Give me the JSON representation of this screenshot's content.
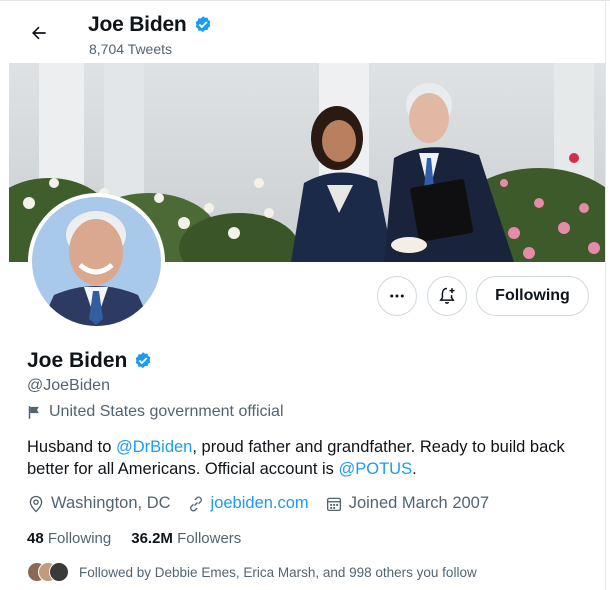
{
  "header": {
    "name": "Joe Biden",
    "tweet_count": "8,704 Tweets"
  },
  "icons": {
    "back": "arrow-left-icon",
    "verified": "verified-badge-icon",
    "more": "more-horizontal-icon",
    "notify": "bell-plus-icon",
    "affiliation": "flag-icon",
    "location": "location-pin-icon",
    "link": "link-icon",
    "joined": "calendar-icon"
  },
  "actions": {
    "following_label": "Following"
  },
  "profile": {
    "name": "Joe Biden",
    "handle": "@JoeBiden",
    "affiliation": "United States government official",
    "bio_part1": "Husband to ",
    "bio_mention1": "@DrBiden",
    "bio_part2": ", proud father and grandfather. Ready to build back better for all Americans. Official account is ",
    "bio_mention2": "@POTUS",
    "bio_part3": ".",
    "location": "Washington, DC",
    "website": "joebiden.com",
    "joined": "Joined March 2007"
  },
  "stats": {
    "following_count": "48",
    "following_label": "Following",
    "followers_count": "36.2M",
    "followers_label": "Followers"
  },
  "followed_by": "Followed by Debbie Emes, Erica Marsh, and 998 others you follow",
  "colors": {
    "accent": "#1d9bf0",
    "text": "#0f1419",
    "secondary": "#536471",
    "border": "#cfd9de"
  }
}
